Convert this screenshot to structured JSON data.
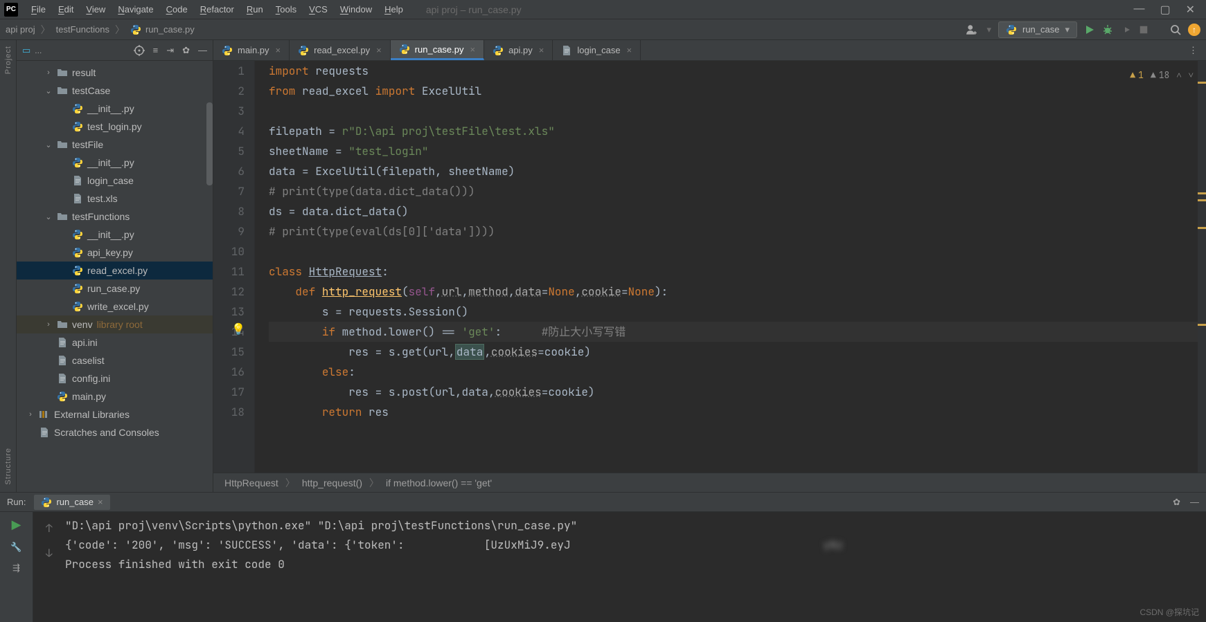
{
  "window_title": "api proj – run_case.py",
  "menu": [
    "File",
    "Edit",
    "View",
    "Navigate",
    "Code",
    "Refactor",
    "Run",
    "Tools",
    "VCS",
    "Window",
    "Help"
  ],
  "breadcrumbs": [
    "api proj",
    "testFunctions",
    "run_case.py"
  ],
  "run_config": "run_case",
  "inspections": {
    "warn1_count": "1",
    "warn2_count": "18"
  },
  "tabs": [
    {
      "label": "main.py",
      "active": false,
      "icon": "py"
    },
    {
      "label": "read_excel.py",
      "active": false,
      "icon": "py"
    },
    {
      "label": "run_case.py",
      "active": true,
      "icon": "py"
    },
    {
      "label": "api.py",
      "active": false,
      "icon": "py"
    },
    {
      "label": "login_case",
      "active": false,
      "icon": "txt"
    }
  ],
  "tree": [
    {
      "d": 1,
      "chev": ">",
      "icon": "dir",
      "label": "result"
    },
    {
      "d": 1,
      "chev": "v",
      "icon": "dir",
      "label": "testCase"
    },
    {
      "d": 2,
      "chev": "",
      "icon": "py",
      "label": "__init__.py"
    },
    {
      "d": 2,
      "chev": "",
      "icon": "py",
      "label": "test_login.py"
    },
    {
      "d": 1,
      "chev": "v",
      "icon": "dir",
      "label": "testFile"
    },
    {
      "d": 2,
      "chev": "",
      "icon": "py",
      "label": "__init__.py"
    },
    {
      "d": 2,
      "chev": "",
      "icon": "txt",
      "label": "login_case"
    },
    {
      "d": 2,
      "chev": "",
      "icon": "txt",
      "label": "test.xls"
    },
    {
      "d": 1,
      "chev": "v",
      "icon": "dir",
      "label": "testFunctions"
    },
    {
      "d": 2,
      "chev": "",
      "icon": "py",
      "label": "__init__.py"
    },
    {
      "d": 2,
      "chev": "",
      "icon": "py",
      "label": "api_key.py"
    },
    {
      "d": 2,
      "chev": "",
      "icon": "py",
      "label": "read_excel.py",
      "sel": true
    },
    {
      "d": 2,
      "chev": "",
      "icon": "py",
      "label": "run_case.py"
    },
    {
      "d": 2,
      "chev": "",
      "icon": "py",
      "label": "write_excel.py"
    },
    {
      "d": 1,
      "chev": ">",
      "icon": "dir",
      "label": "venv",
      "suffix": "library root",
      "muted": true
    },
    {
      "d": 1,
      "chev": "",
      "icon": "txt",
      "label": "api.ini"
    },
    {
      "d": 1,
      "chev": "",
      "icon": "txt",
      "label": "caselist"
    },
    {
      "d": 1,
      "chev": "",
      "icon": "txt",
      "label": "config.ini"
    },
    {
      "d": 1,
      "chev": "",
      "icon": "py",
      "label": "main.py"
    },
    {
      "d": 0,
      "chev": ">",
      "icon": "lib",
      "label": "External Libraries"
    },
    {
      "d": 0,
      "chev": "",
      "icon": "scr",
      "label": "Scratches and Consoles"
    }
  ],
  "code_lines": [
    {
      "n": 1,
      "html": "<span class='kw'>import</span> <span class='id'>requests</span>"
    },
    {
      "n": 2,
      "html": "<span class='kw'>from</span> <span class='id'>read_excel</span> <span class='kw'>import</span> <span class='id'>ExcelUtil</span>"
    },
    {
      "n": 3,
      "html": ""
    },
    {
      "n": 4,
      "html": "<span class='id'>filepath</span> = <span class='str'>r\"D:\\api proj\\testFile\\test.xls\"</span>"
    },
    {
      "n": 5,
      "html": "<span class='id'>sheetName</span> = <span class='str'>\"test_login\"</span>"
    },
    {
      "n": 6,
      "html": "<span class='id'>data</span> = <span class='id'>ExcelUtil</span>(<span class='id'>filepath</span><span class='op'>,</span> <span class='id'>sheetName</span>)"
    },
    {
      "n": 7,
      "html": "<span class='com'># print(type(data.dict_data()))</span>"
    },
    {
      "n": 8,
      "html": "<span class='id'>ds</span> = <span class='id'>data</span>.<span class='id'>dict_data</span>()"
    },
    {
      "n": 9,
      "html": "<span class='com'># print(type(eval(ds[0]['data'])))</span>"
    },
    {
      "n": 10,
      "html": ""
    },
    {
      "n": 11,
      "html": "<span class='kw'>class</span> <span class='cname'>HttpRequest</span>:"
    },
    {
      "n": 12,
      "html": "    <span class='kw'>def</span> <span class='mname'>http_request</span>(<span class='slf'>self</span><span class='op'>,</span><span class='param'>url</span><span class='op'>,</span><span class='param'>method</span><span class='op'>,</span><span class='param'>data</span>=<span class='kw'>None</span><span class='op'>,</span><span class='param'>cookie</span>=<span class='kw'>None</span>):"
    },
    {
      "n": 13,
      "html": "        <span class='id'>s</span> = <span class='id'>requests</span>.<span class='id'>Session</span>()"
    },
    {
      "n": 14,
      "hl": true,
      "html": "        <span class='kw'>if</span> <span class='id'>method</span>.<span class='id'>lower</span>() == <span class='str'>'get'</span>:      <span class='com'>#防止大小写写错</span>"
    },
    {
      "n": 15,
      "html": "            <span class='id'>res</span> = <span class='id'>s</span>.<span class='id'>get</span>(<span class='id'>url</span><span class='op'>,</span><span class='hlbox'>data</span><span class='op'>,</span><span class='param'>cookies</span>=<span class='id'>cookie</span>)"
    },
    {
      "n": 16,
      "html": "        <span class='kw'>else</span>:"
    },
    {
      "n": 17,
      "html": "            <span class='id'>res</span> = <span class='id'>s</span>.<span class='id'>post</span>(<span class='id'>url</span><span class='op'>,</span><span class='id'>data</span><span class='op'>,</span><span class='param'>cookies</span>=<span class='id'>cookie</span>)"
    },
    {
      "n": 18,
      "html": "        <span class='kw'>return</span> <span class='id'>res</span>"
    }
  ],
  "editor_crumb": [
    "HttpRequest",
    "http_request()",
    "if method.lower() == 'get'"
  ],
  "run": {
    "title": "Run:",
    "tab": "run_case",
    "lines": [
      "\"D:\\api proj\\venv\\Scripts\\python.exe\" \"D:\\api proj\\testFunctions\\run_case.py\"",
      "{'code': '200', 'msg': 'SUCCESS', 'data': {'token':            [UzUxMiJ9.eyJ                                      yNz",
      "",
      "Process finished with exit code 0"
    ]
  },
  "watermark": "CSDN @探坑记"
}
